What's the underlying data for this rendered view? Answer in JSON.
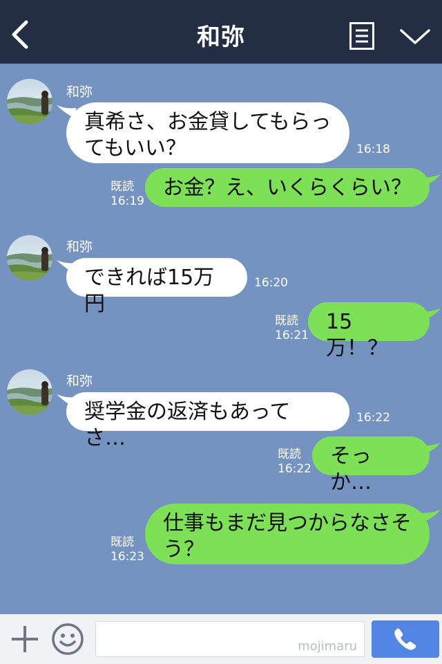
{
  "header": {
    "title": "和弥",
    "back_icon": "chevron-left-icon",
    "menu_icon": "list-icon",
    "collapse_icon": "chevron-down-icon"
  },
  "messages": [
    {
      "from": "in",
      "sender": "和弥",
      "text": "真希さ、お金貸してもらってもいい？",
      "line1": "真希さ、お金貸してもらっ",
      "line2": "てもいい？",
      "time": "16:18"
    },
    {
      "from": "out",
      "read": "既読",
      "text": "お金？え、いくらくらい？",
      "time": "16:19"
    },
    {
      "from": "in",
      "sender": "和弥",
      "text": "できれば15万円",
      "time": "16:20"
    },
    {
      "from": "out",
      "read": "既読",
      "text": "15万！？",
      "time": "16:21"
    },
    {
      "from": "in",
      "sender": "和弥",
      "text": "奨学金の返済もあってさ…",
      "time": "16:22"
    },
    {
      "from": "out",
      "read": "既読",
      "text": "そっか…",
      "time": "16:22"
    },
    {
      "from": "out",
      "read": "既読",
      "text": "仕事もまだ見つからなさそう？",
      "line1": "仕事もまだ見つからなさそ",
      "line2": "う？",
      "time": "16:23"
    }
  ],
  "footer": {
    "plus_icon": "plus-icon",
    "emoji_icon": "smiley-icon",
    "input_placeholder": "",
    "watermark": "mojimaru",
    "call_icon": "phone-icon"
  },
  "colors": {
    "background": "#7493c1",
    "header": "#232d43",
    "outgoing_bubble": "#7ee057",
    "incoming_bubble": "#ffffff",
    "call_button": "#5386e4"
  }
}
